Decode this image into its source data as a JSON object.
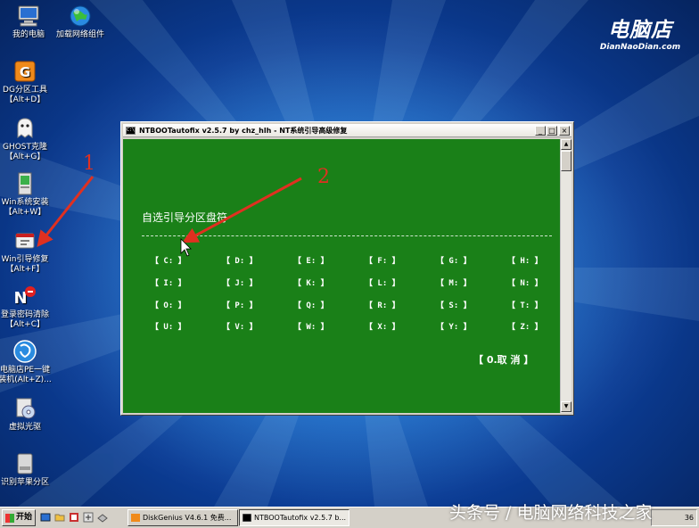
{
  "desktop": {
    "icons": [
      {
        "label": "我的电脑",
        "icon": "computer-icon"
      },
      {
        "label": "加载网络组件",
        "icon": "globe-icon"
      },
      {
        "label": "DG分区工具\n【Alt+D】",
        "icon": "diskgenius-icon"
      },
      {
        "label": "GHOST克隆\n【Alt+G】",
        "icon": "ghost-icon"
      },
      {
        "label": "Win系统安装\n【Alt+W】",
        "icon": "win-install-icon"
      },
      {
        "label": "Win引导修复\n【Alt+F】",
        "icon": "boot-repair-icon"
      },
      {
        "label": "登录密码清除\n【Alt+C】",
        "icon": "password-clear-icon"
      },
      {
        "label": "电脑店PE一键\n装机(Alt+Z)...",
        "icon": "one-click-install-icon"
      },
      {
        "label": "虚拟光驱",
        "icon": "virtual-drive-icon"
      },
      {
        "label": "识别苹果分区",
        "icon": "apple-partition-icon"
      }
    ]
  },
  "brand": {
    "title": "电脑店",
    "subtitle": "DianNaoDian.com"
  },
  "window": {
    "title": "NTBOOTautofix v2.5.7 by chz_hlh - NT系统引导高级修复",
    "console_icon": "C:\\",
    "min": "_",
    "max": "□",
    "close": "×",
    "heading": "自选引导分区盘符",
    "drives": [
      "【 C: 】",
      "【 D: 】",
      "【 E: 】",
      "【 F: 】",
      "【 G: 】",
      "【 H: 】",
      "【 I: 】",
      "【 J: 】",
      "【 K: 】",
      "【 L: 】",
      "【 M: 】",
      "【 N: 】",
      "【 O: 】",
      "【 P: 】",
      "【 Q: 】",
      "【 R: 】",
      "【 S: 】",
      "【 T: 】",
      "【 U: 】",
      "【 V: 】",
      "【 W: 】",
      "【 X: 】",
      "【 Y: 】",
      "【 Z: 】"
    ],
    "cancel": "【 0.取  消 】"
  },
  "annotations": {
    "one": "1",
    "two": "2"
  },
  "taskbar": {
    "start": "开始",
    "tasks": [
      {
        "label": "DiskGenius V4.6.1 免费...",
        "active": false
      },
      {
        "label": "NTBOOTautofix v2.5.7 b...",
        "active": true
      }
    ],
    "tray_time": "36"
  },
  "watermark": "头条号 / 电脑网络科技之家",
  "colors": {
    "console_bg": "#1a8018",
    "annotation": "#e03020"
  }
}
